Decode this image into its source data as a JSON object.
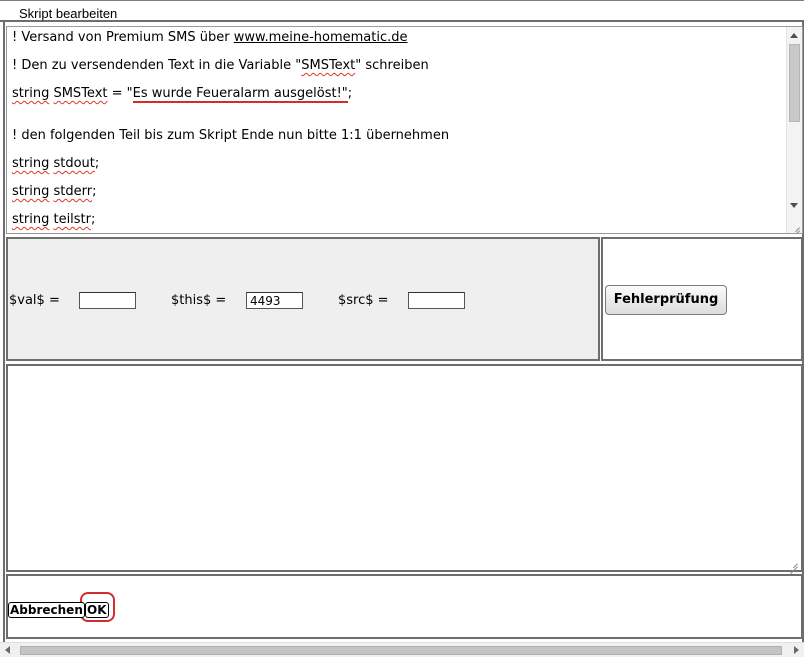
{
  "dialog": {
    "title": "Skript bearbeiten"
  },
  "editor": {
    "lines": [
      {
        "a": "! Versand von Premium SMS über ",
        "b": "www.meine-homematic.de"
      },
      {
        "a": "! Den zu versendenden Text in die Variable \"",
        "b": "SMSText",
        "c": "\" schreiben"
      },
      {
        "a": "string",
        "b": " ",
        "c": "SMSText",
        "d": " = \"",
        "e": "Es wurde Feueralarm ausgelöst!\"",
        "f": ";"
      },
      {
        "a": "! den folgenden Teil bis zum Skript Ende nun bitte 1:1 übernehmen"
      },
      {
        "a": "string",
        "b": " ",
        "c": "stdout",
        "d": ";"
      },
      {
        "a": "string",
        "b": " ",
        "c": "stderr",
        "d": ";"
      },
      {
        "a": "string",
        "b": " ",
        "c": "teilstr",
        "d": ";"
      }
    ]
  },
  "params": {
    "val_label": "$val$ =",
    "val_value": "",
    "this_label": "$this$ =",
    "this_value": "4493",
    "src_label": "$src$ =",
    "src_value": ""
  },
  "check_button": "Fehlerprüfung",
  "footer": {
    "cancel": "Abbrechen",
    "ok": "OK"
  },
  "colors": {
    "highlight": "#d42b2b",
    "panel": "#efefef",
    "border": "#6e6e6e"
  }
}
